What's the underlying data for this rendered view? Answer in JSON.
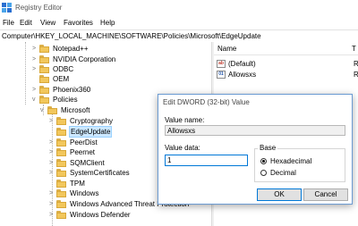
{
  "window": {
    "title": "Registry Editor"
  },
  "menu": {
    "file": "File",
    "edit": "Edit",
    "view": "View",
    "favorites": "Favorites",
    "help": "Help"
  },
  "address": {
    "path": "Computer\\HKEY_LOCAL_MACHINE\\SOFTWARE\\Policies\\Microsoft\\EdgeUpdate"
  },
  "tree": {
    "items": [
      {
        "label": "Notepad++",
        "expander": ">"
      },
      {
        "label": "NVIDIA Corporation",
        "expander": ">"
      },
      {
        "label": "ODBC",
        "expander": ">"
      },
      {
        "label": "OEM",
        "expander": ""
      },
      {
        "label": "Phoenix360",
        "expander": ">"
      },
      {
        "label": "Policies",
        "expander": "v"
      },
      {
        "label": "Microsoft",
        "expander": "v"
      },
      {
        "label": "Cryptography",
        "expander": ">"
      },
      {
        "label": "EdgeUpdate",
        "expander": "",
        "selected": true
      },
      {
        "label": "PeerDist",
        "expander": ">"
      },
      {
        "label": "Peernet",
        "expander": ">"
      },
      {
        "label": "SQMClient",
        "expander": ">"
      },
      {
        "label": "SystemCertificates",
        "expander": ">"
      },
      {
        "label": "TPM",
        "expander": ""
      },
      {
        "label": "Windows",
        "expander": ">"
      },
      {
        "label": "Windows Advanced Threat Protection",
        "expander": ">"
      },
      {
        "label": "Windows Defender",
        "expander": ">"
      }
    ]
  },
  "values": {
    "header_name": "Name",
    "header_type": "T",
    "rows": [
      {
        "name": "(Default)",
        "type": "R",
        "icon": "string-value-icon",
        "glyph": "ab"
      },
      {
        "name": "Allowsxs",
        "type": "R",
        "icon": "dword-value-icon",
        "glyph": "01"
      }
    ]
  },
  "dialog": {
    "title": "Edit DWORD (32-bit) Value",
    "value_name_label": "Value name:",
    "value_name": "Allowsxs",
    "value_data_label": "Value data:",
    "value_data": "1",
    "base_label": "Base",
    "base_options": [
      {
        "label": "Hexadecimal",
        "selected": true
      },
      {
        "label": "Decimal",
        "selected": false
      }
    ],
    "ok_label": "OK",
    "cancel_label": "Cancel"
  },
  "colors": {
    "selection": "#cce8ff",
    "dialog_border": "#6b9bd2",
    "focus_blue": "#0078d7",
    "folder": "#f2c75c"
  }
}
